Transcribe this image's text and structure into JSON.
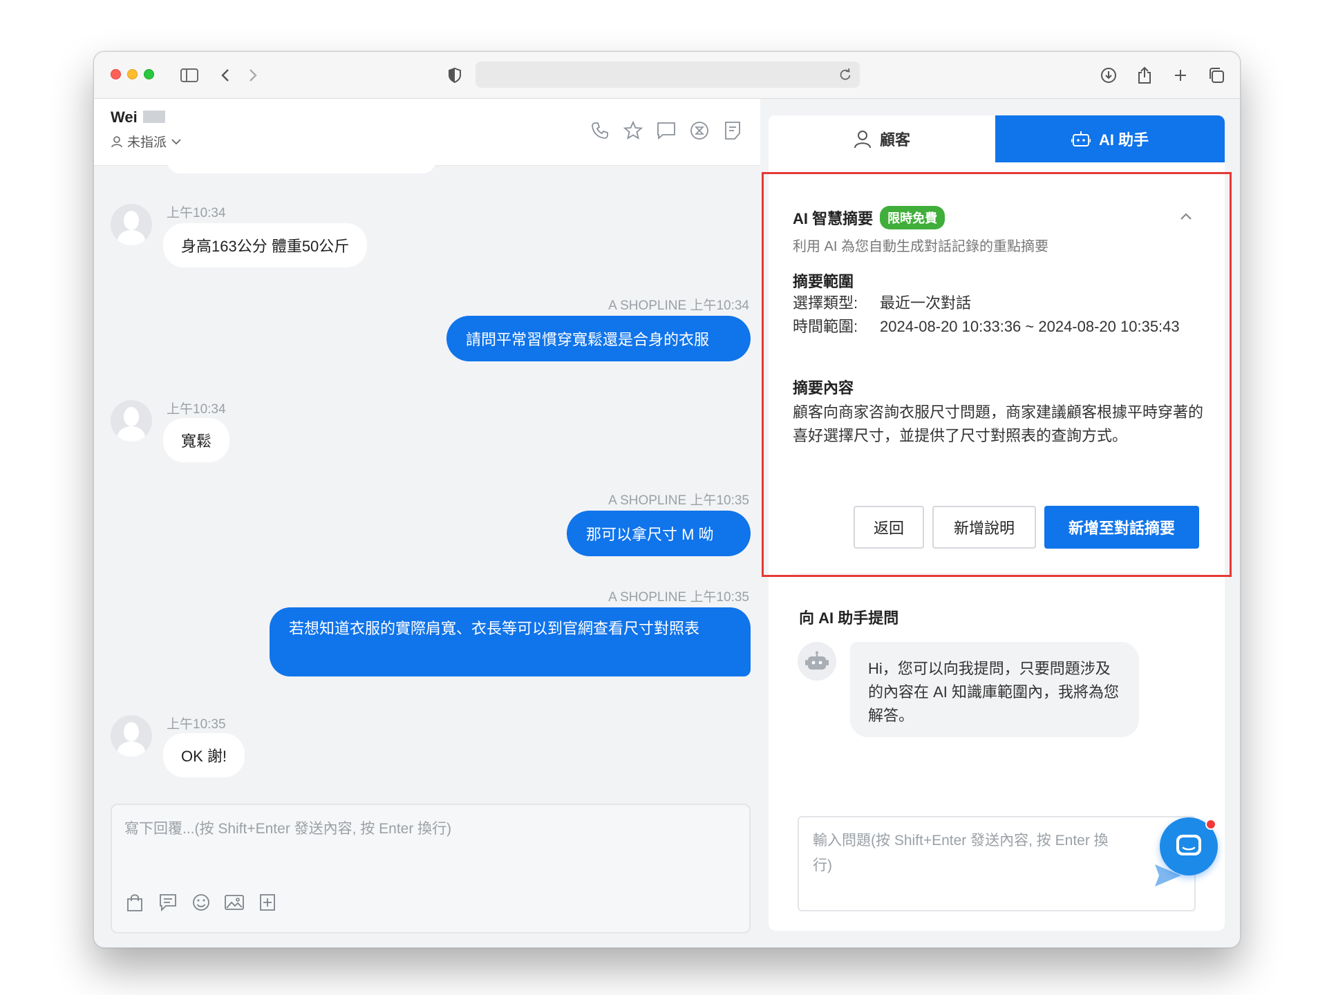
{
  "chat": {
    "contact_name": "Wei",
    "assign_label": "未指派"
  },
  "messages": [
    {
      "direction": "in",
      "time": "上午10:34",
      "text": "身高163公分 體重50公斤"
    },
    {
      "direction": "out",
      "sender": "A SHOPLINE",
      "time": "上午10:34",
      "text": "請問平常習慣穿寬鬆還是合身的衣服"
    },
    {
      "direction": "in",
      "time": "上午10:34",
      "text": "寬鬆"
    },
    {
      "direction": "out",
      "sender": "A SHOPLINE",
      "time": "上午10:35",
      "text": "那可以拿尺寸 M 呦"
    },
    {
      "direction": "out",
      "sender": "A SHOPLINE",
      "time": "上午10:35",
      "text": "若想知道衣服的實際肩寬、衣長等可以到官網查看尺寸對照表"
    },
    {
      "direction": "in",
      "time": "上午10:35",
      "text": "OK 謝!"
    }
  ],
  "composer": {
    "placeholder": "寫下回覆...(按 Shift+Enter 發送內容, 按 Enter 換行)"
  },
  "tabs": {
    "customer": "顧客",
    "ai": "AI 助手"
  },
  "summary": {
    "title": "AI 智慧摘要",
    "badge": "限時免費",
    "subtitle": "利用 AI 為您自動生成對話記錄的重點摘要",
    "range_heading": "摘要範圍",
    "type_label": "選擇類型:",
    "type_value": "最近一次對話",
    "time_label": "時間範圍:",
    "time_value": "2024-08-20 10:33:36 ~ 2024-08-20 10:35:43",
    "content_heading": "摘要內容",
    "content_text": "顧客向商家咨詢衣服尺寸問題，商家建議顧客根據平時穿著的喜好選擇尺寸，並提供了尺寸對照表的查詢方式。",
    "back_button": "返回",
    "add_note_button": "新增說明",
    "add_summary_button": "新增至對話摘要"
  },
  "ask": {
    "title": "向 AI 助手提問",
    "greeting": "Hi，您可以向我提問，只要問題涉及的內容在 AI 知識庫範圍內，我將為您解答。",
    "input_placeholder": "輸入問題(按 Shift+Enter 發送內容, 按 Enter 換行)"
  },
  "colors": {
    "accent": "#1074ea",
    "badge": "#3fae3a",
    "highlight": "#e53935"
  }
}
